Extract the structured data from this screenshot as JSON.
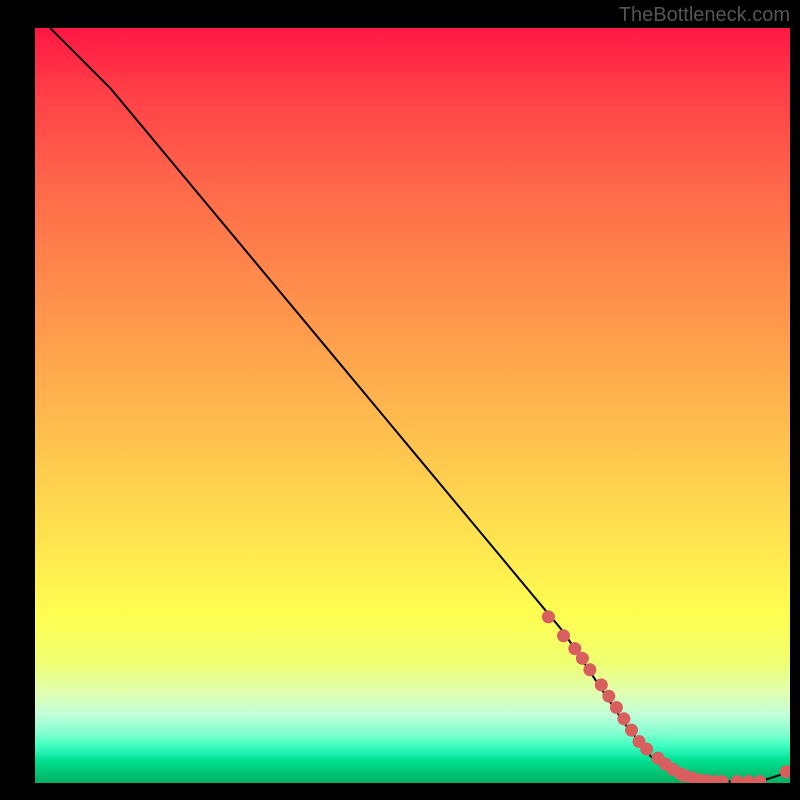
{
  "attribution": "TheBottleneck.com",
  "chart_data": {
    "type": "line",
    "title": "",
    "xlabel": "",
    "ylabel": "",
    "xlim": [
      0,
      100
    ],
    "ylim": [
      0,
      100
    ],
    "line": {
      "x": [
        2,
        5,
        10,
        20,
        30,
        40,
        50,
        60,
        70,
        78,
        82,
        85,
        88,
        92,
        96,
        100
      ],
      "y": [
        100,
        97,
        92,
        80,
        68,
        56,
        44,
        32,
        20,
        8,
        3,
        1,
        0.3,
        0.2,
        0.2,
        1.5
      ]
    },
    "markers": {
      "color": "#d95f5f",
      "x": [
        68,
        70,
        71.5,
        72.5,
        73.5,
        75,
        76,
        77,
        78,
        79,
        80,
        81,
        82.5,
        83.5,
        84.5,
        85.5,
        86,
        87,
        88,
        89,
        90,
        91,
        93,
        94.5,
        96,
        99.5
      ],
      "y": [
        22,
        19.5,
        17.8,
        16.5,
        15,
        13,
        11.5,
        10,
        8.5,
        7,
        5.5,
        4.5,
        3.3,
        2.5,
        1.8,
        1.2,
        1.0,
        0.7,
        0.4,
        0.3,
        0.2,
        0.2,
        0.2,
        0.2,
        0.2,
        1.5
      ]
    }
  }
}
